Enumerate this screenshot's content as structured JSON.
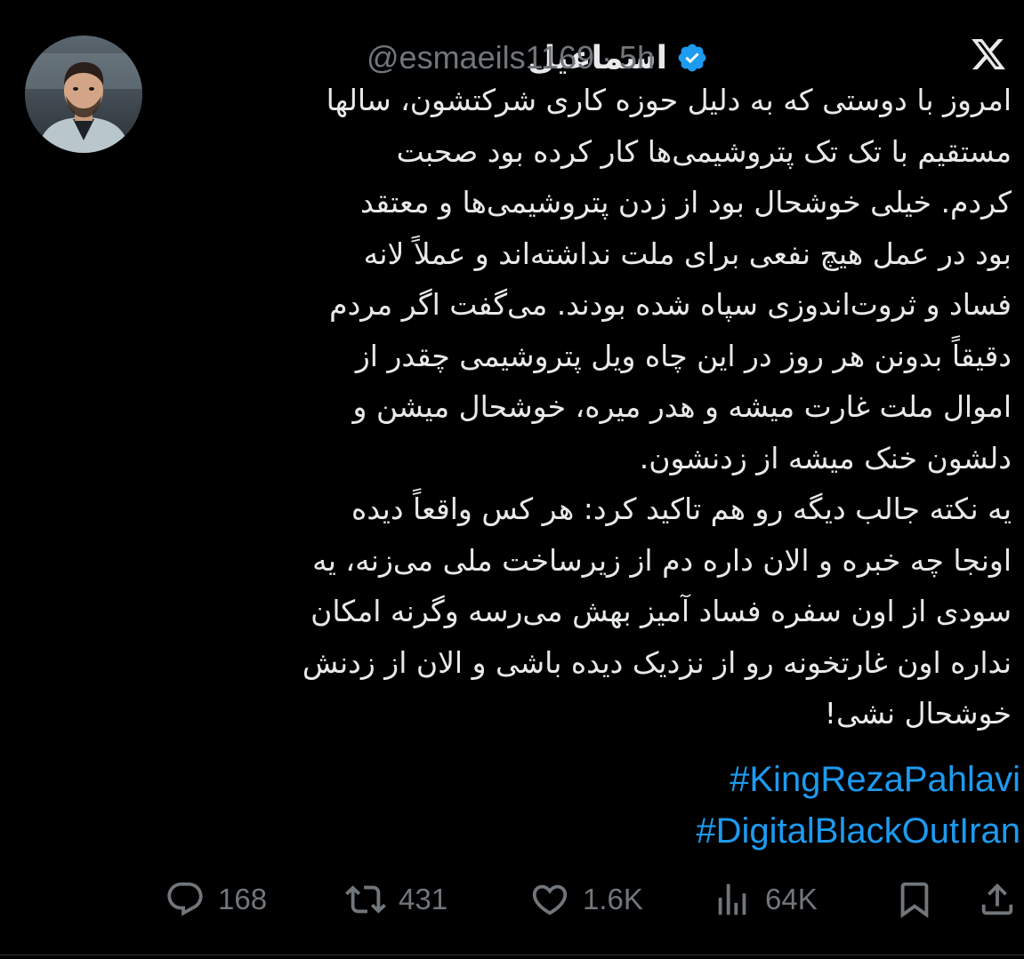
{
  "author": {
    "display_name": "اسماعیل",
    "handle": "@esmaeils1169",
    "separator": "·",
    "time_ago": "5h",
    "verified_icon": "verified-badge-icon",
    "avatar_icon": "avatar-photo"
  },
  "brand": {
    "logo_icon": "x-logo-icon"
  },
  "tweet": {
    "lines": [
      "امروز با دوستی که به دلیل حوزه کاری شرکتشون، سالها",
      "مستقیم با تک تک پتروشیمی‌ها کار کرده بود صحبت",
      "کردم. خیلی خوشحال بود از زدن پتروشیمی‌ها و معتقد",
      "بود در عمل هیچ نفعی برای ملت نداشته‌اند و عملاً لانه",
      "فساد و ثروت‌اندوزی سپاه شده بودند. می‌گفت اگر مردم",
      "دقیقاً بدونن هر روز در این چاه ویل پتروشیمی چقدر از",
      "اموال ملت غارت میشه و هدر میره، خوشحال میشن و",
      "دلشون خنک میشه از زدنشون.",
      "یه نکته جالب دیگه رو هم تاکید کرد: هر کس واقعاً دیده",
      "اونجا چه خبره و الان داره دم از زیرساخت ملی می‌زنه، یه",
      "سودی از اون سفره فساد آمیز بهش می‌رسه وگرنه امکان",
      "نداره اون غارتخونه رو از نزدیک دیده باشی و الان از زدنش",
      "خوشحال نشی!"
    ],
    "hashtags": [
      "#KingRezaPahlavi",
      "#DigitalBlackOutIran"
    ]
  },
  "actions": {
    "reply": {
      "icon": "reply-icon",
      "count": "168"
    },
    "retweet": {
      "icon": "retweet-icon",
      "count": "431"
    },
    "like": {
      "icon": "heart-icon",
      "count": "1.6K"
    },
    "views": {
      "icon": "views-icon",
      "count": "64K"
    },
    "bookmark": {
      "icon": "bookmark-icon"
    },
    "share": {
      "icon": "share-icon"
    }
  },
  "colors": {
    "background": "#000000",
    "text": "#e7e9ea",
    "muted": "#71767b",
    "link": "#1d9bf0",
    "verified": "#1d9bf0"
  }
}
